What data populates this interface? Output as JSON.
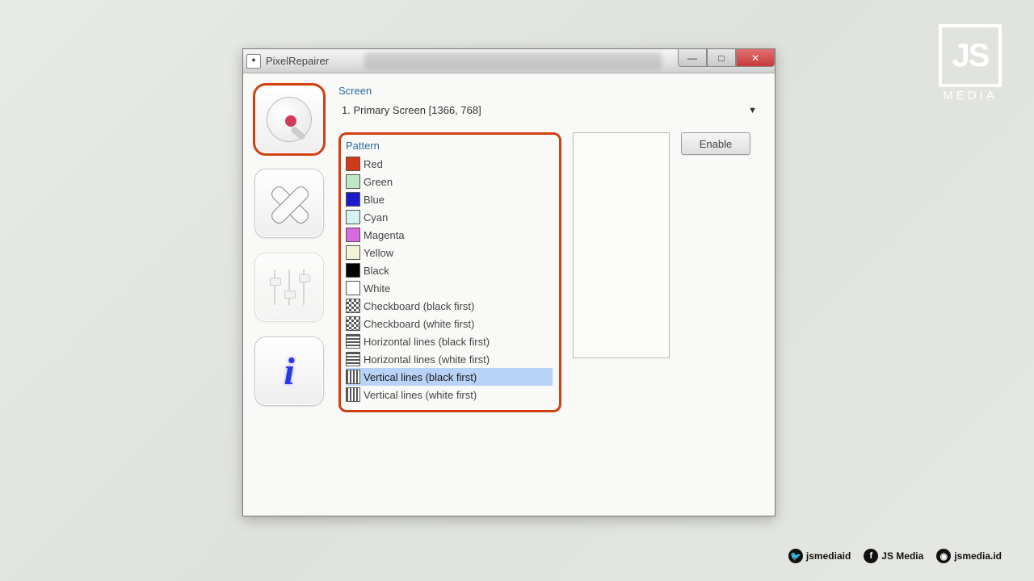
{
  "window": {
    "title": "PixelRepairer",
    "controls": {
      "minimize": "—",
      "maximize": "□",
      "close": "✕"
    }
  },
  "sidebar": {
    "items": [
      {
        "name": "search-lens",
        "active": true,
        "disabled": false
      },
      {
        "name": "repair-patch",
        "active": false,
        "disabled": false
      },
      {
        "name": "settings-sliders",
        "active": false,
        "disabled": true
      },
      {
        "name": "info",
        "active": false,
        "disabled": false
      }
    ]
  },
  "screen": {
    "label": "Screen",
    "selected": "1. Primary Screen [1366, 768]"
  },
  "pattern": {
    "label": "Pattern",
    "selected_index": 12,
    "items": [
      {
        "label": "Red",
        "swatch": "#d03a18"
      },
      {
        "label": "Green",
        "swatch": "#bfe8c6"
      },
      {
        "label": "Blue",
        "swatch": "#1a1acc"
      },
      {
        "label": "Cyan",
        "swatch": "#d4f4f4"
      },
      {
        "label": "Magenta",
        "swatch": "#d86adf"
      },
      {
        "label": "Yellow",
        "swatch": "#f3f4d6"
      },
      {
        "label": "Black",
        "swatch": "#000000"
      },
      {
        "label": "White",
        "swatch": "#ffffff"
      },
      {
        "label": "Checkboard (black first)",
        "swatch_class": "sw-checkboard"
      },
      {
        "label": "Checkboard (white first)",
        "swatch_class": "sw-checkboard"
      },
      {
        "label": "Horizontal lines (black first)",
        "swatch_class": "sw-hlines"
      },
      {
        "label": "Horizontal lines (white first)",
        "swatch_class": "sw-hlines"
      },
      {
        "label": "Vertical lines (black first)",
        "swatch_class": "sw-vlines"
      },
      {
        "label": "Vertical lines (white first)",
        "swatch_class": "sw-vlines"
      }
    ]
  },
  "buttons": {
    "enable": "Enable"
  },
  "branding": {
    "logo": "JS",
    "logo_sub": "MEDIA",
    "socials": [
      {
        "icon": "twitter",
        "glyph": "🐦",
        "handle": "jsmediaid"
      },
      {
        "icon": "facebook",
        "glyph": "f",
        "handle": "JS Media"
      },
      {
        "icon": "instagram",
        "glyph": "◉",
        "handle": "jsmedia.id"
      }
    ]
  }
}
